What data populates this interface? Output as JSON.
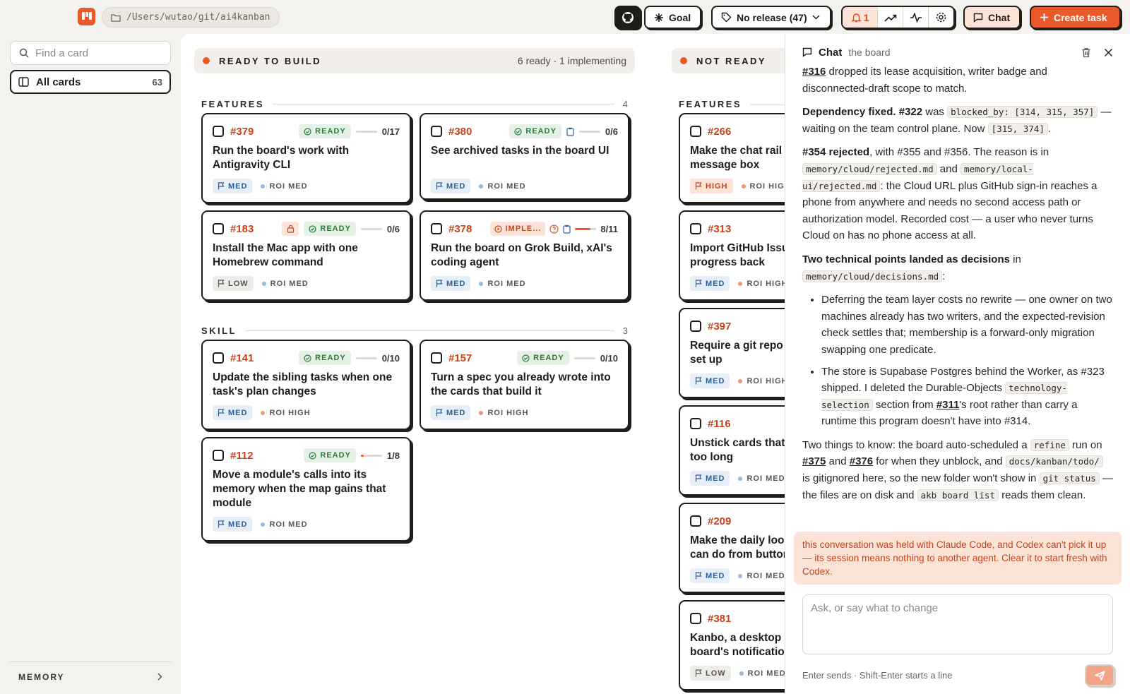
{
  "header": {
    "path": "/Users/wutao/git/ai4kanban",
    "goal_label": "Goal",
    "release_label": "No release (47)",
    "notification_count": "1",
    "chat_label": "Chat",
    "create_label": "Create task"
  },
  "sidebar": {
    "search_placeholder": "Find a card",
    "all_cards_label": "All cards",
    "all_cards_count": "63",
    "memory_label": "MEMORY"
  },
  "columns": [
    {
      "title": "READY TO BUILD",
      "meta": "6 ready · 1 implementing",
      "groups": [
        {
          "label": "FEATURES",
          "count": "4",
          "cards": [
            {
              "num": "#379",
              "status": "READY",
              "progress": "0/17",
              "progress_fraction": 0,
              "title": "Run the board's work with Antigravity CLI",
              "priority": "MED",
              "roi": "ROI MED"
            },
            {
              "num": "#380",
              "status": "READY",
              "progress": "0/6",
              "progress_fraction": 0,
              "title": "See archived tasks in the board UI",
              "priority": "MED",
              "roi": "ROI MED"
            },
            {
              "num": "#183",
              "status": "READY",
              "progress": "0/6",
              "progress_fraction": 0,
              "title": "Install the Mac app with one Homebrew command",
              "priority": "LOW",
              "roi": "ROI MED"
            },
            {
              "num": "#378",
              "status": "IMPLE...",
              "progress": "8/11",
              "progress_fraction": 0.73,
              "title": "Run the board on Grok Build, xAI's coding agent",
              "priority": "MED",
              "roi": "ROI MED"
            }
          ]
        },
        {
          "label": "SKILL",
          "count": "3",
          "cards": [
            {
              "num": "#141",
              "status": "READY",
              "progress": "0/10",
              "progress_fraction": 0,
              "title": "Update the sibling tasks when one task's plan changes",
              "priority": "MED",
              "roi": "ROI HIGH"
            },
            {
              "num": "#157",
              "status": "READY",
              "progress": "0/10",
              "progress_fraction": 0,
              "title": "Turn a spec you already wrote into the cards that build it",
              "priority": "MED",
              "roi": "ROI HIGH"
            },
            {
              "num": "#112",
              "status": "READY",
              "progress": "1/8",
              "progress_fraction": 0.125,
              "title": "Move a module's calls into its memory when the map gains that module",
              "priority": "MED",
              "roi": "ROI MED"
            }
          ]
        }
      ]
    },
    {
      "title": "NOT READY",
      "groups": [
        {
          "label": "FEATURES",
          "cards": [
            {
              "num": "#266",
              "title": "Make the chat rail a",
              "title2": "message box",
              "priority": "HIGH",
              "roi": "ROI HIG"
            },
            {
              "num": "#313",
              "title": "Import GitHub Issu",
              "title2": "progress back",
              "priority": "MED",
              "roi": "ROI HIGH"
            },
            {
              "num": "#397",
              "title": "Require a git repo v",
              "title2": "set up",
              "priority": "MED",
              "roi": "ROI HIGH"
            },
            {
              "num": "#116",
              "title": "Unstick cards that",
              "title2": "too long",
              "priority": "MED",
              "roi": "ROI MED"
            },
            {
              "num": "#209",
              "title": "Make the daily loop",
              "title2": "can do from buttor",
              "priority": "MED",
              "roi": "ROI MED"
            },
            {
              "num": "#381",
              "title": "Kanbo, a desktop p",
              "title2": "board's notificatio",
              "priority": "LOW",
              "roi": "ROI MED"
            }
          ]
        }
      ]
    }
  ],
  "chat": {
    "title": "Chat",
    "subtitle": "the board",
    "p1_ref": "#316",
    "p1_text": " dropped its lease acquisition, writer badge and disconnected-draft scope to match.",
    "p2_bold": "Dependency fixed. #322",
    "p2_t1": " was ",
    "p2_code1": "blocked_by: [314, 315, 357]",
    "p2_t2": " — waiting on the team control plane. Now ",
    "p2_code2": "[315, 374]",
    "p2_t3": ".",
    "p3_bold": "#354 rejected",
    "p3_t1": ", with #355 and #356. The reason is in ",
    "p3_code1": "memory/cloud/rejected.md",
    "p3_t2": " and ",
    "p3_code2": "memory/local-ui/rejected.md",
    "p3_t3": ": the Cloud URL plus GitHub sign-in reaches a phone from anywhere and needs no second access path or authorization model. Recorded cost — a user who never turns Cloud on has no phone access at all.",
    "p4_bold": "Two technical points landed as decisions",
    "p4_t1": " in ",
    "p4_code": "memory/cloud/decisions.md",
    "p4_t2": ":",
    "li1": "Deferring the team layer costs no rewrite — one owner on two machines already has two writers, and the expected-revision check settles that; membership is a forward-only migration swapping one predicate.",
    "li2_t1": "The store is Supabase Postgres behind the Worker, as #323 shipped. I deleted the Durable-Objects ",
    "li2_code": "technology-selection",
    "li2_t2": " section from ",
    "li2_ref": "#311",
    "li2_t3": "'s root rather than carry a runtime this program doesn't have into #314.",
    "p5_t1": "Two things to know: the board auto-scheduled a ",
    "p5_code1": "refine",
    "p5_t2": " run on ",
    "p5_ref1": "#375",
    "p5_t3": " and ",
    "p5_ref2": "#376",
    "p5_t4": " for when they unblock, and ",
    "p5_code2": "docs/kanban/todo/",
    "p5_t5": " is gitignored here, so the new folder won't show in ",
    "p5_code3": "git status",
    "p5_t6": " — the files are on disk and ",
    "p5_code4": "akb board list",
    "p5_t7": " reads them clean.",
    "warning": "this conversation was held with Claude Code, and Codex can't pick it up — its session means nothing to another agent. Clear it to start fresh with Codex.",
    "input_placeholder": "Ask, or say what to change",
    "hint": "Enter sends · Shift-Enter starts a line"
  },
  "colors": {
    "accent": "#e85a2b",
    "ready_green": "#2e7a3a",
    "priority_med": "#2f5f96"
  }
}
